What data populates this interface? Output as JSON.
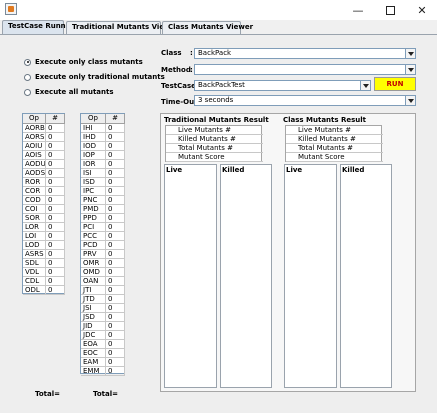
{
  "titlebar": {
    "minimize": "—",
    "close": "✕"
  },
  "tabs": [
    {
      "label": "TestCase Runner"
    },
    {
      "label": "Traditional Mutants Viewer"
    },
    {
      "label": "Class Mutants Viewer"
    }
  ],
  "options": [
    {
      "label": "Execute only class mutants",
      "selected": true
    },
    {
      "label": "Execute only traditional mutants",
      "selected": false
    },
    {
      "label": "Execute all mutants",
      "selected": false
    }
  ],
  "table1": {
    "headers": [
      "Op",
      "#"
    ],
    "rows": [
      [
        "AORB",
        "0"
      ],
      [
        "AORS",
        "0"
      ],
      [
        "AOIU",
        "0"
      ],
      [
        "AOIS",
        "0"
      ],
      [
        "AODU",
        "0"
      ],
      [
        "AODS",
        "0"
      ],
      [
        "ROR",
        "0"
      ],
      [
        "COR",
        "0"
      ],
      [
        "COD",
        "0"
      ],
      [
        "COI",
        "0"
      ],
      [
        "SOR",
        "0"
      ],
      [
        "LOR",
        "0"
      ],
      [
        "LOI",
        "0"
      ],
      [
        "LOD",
        "0"
      ],
      [
        "ASRS",
        "0"
      ],
      [
        "SDL",
        "0"
      ],
      [
        "VDL",
        "0"
      ],
      [
        "CDL",
        "0"
      ],
      [
        "ODL",
        "0"
      ]
    ],
    "total_label": "Total="
  },
  "table2": {
    "headers": [
      "Op",
      "#"
    ],
    "rows": [
      [
        "IHI",
        "0"
      ],
      [
        "IHD",
        "0"
      ],
      [
        "IOD",
        "0"
      ],
      [
        "IOP",
        "0"
      ],
      [
        "IOR",
        "0"
      ],
      [
        "ISI",
        "0"
      ],
      [
        "ISD",
        "0"
      ],
      [
        "IPC",
        "0"
      ],
      [
        "PNC",
        "0"
      ],
      [
        "PMD",
        "0"
      ],
      [
        "PPD",
        "0"
      ],
      [
        "PCI",
        "0"
      ],
      [
        "PCC",
        "0"
      ],
      [
        "PCD",
        "0"
      ],
      [
        "PRV",
        "0"
      ],
      [
        "OMR",
        "0"
      ],
      [
        "OMD",
        "0"
      ],
      [
        "OAN",
        "0"
      ],
      [
        "JTI",
        "0"
      ],
      [
        "JTD",
        "0"
      ],
      [
        "JSI",
        "0"
      ],
      [
        "JSD",
        "0"
      ],
      [
        "JID",
        "0"
      ],
      [
        "JDC",
        "0"
      ],
      [
        "EOA",
        "0"
      ],
      [
        "EOC",
        "0"
      ],
      [
        "EAM",
        "0"
      ],
      [
        "EMM",
        "0"
      ]
    ],
    "total_label": "Total="
  },
  "form": {
    "class_label": "Class",
    "class_colon": ":",
    "class_value": "BackPack",
    "method_label": "Method",
    "method_colon": ":",
    "method_value": "",
    "testcase_label": "TestCase:",
    "testcase_value": "BackPackTest",
    "run_label": "RUN",
    "timeout_label": "Time-Out :",
    "timeout_value": "3 seconds"
  },
  "traditional_result": {
    "title": "Traditional Mutants Result",
    "stats": [
      "Live Mutants #",
      "Killed Mutants #",
      "Total Mutants #",
      "Mutant Score"
    ],
    "live_label": "Live",
    "killed_label": "Killed"
  },
  "class_result": {
    "title": "Class Mutants Result",
    "stats": [
      "Live Mutants #",
      "Killed Mutants #",
      "Total Mutants #",
      "Mutant Score"
    ],
    "live_label": "Live",
    "killed_label": "Killed"
  },
  "colors": {
    "run_button": "#ffff00",
    "run_text": "#c00000",
    "tab_active": "#dbe4ee"
  },
  "icons": {
    "app": "java-app-icon",
    "dropdown": "chevron-down-icon"
  }
}
